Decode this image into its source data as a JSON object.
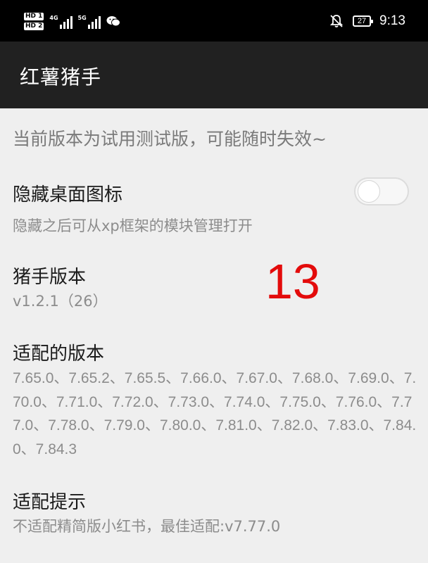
{
  "status_bar": {
    "sim1": "HD 1",
    "sim2": "HD 2",
    "net1": "4G",
    "net2": "5G",
    "battery": "27",
    "time": "9:13",
    "icons": [
      "signal-icon",
      "wechat-icon",
      "mute-bell-icon",
      "battery-icon"
    ]
  },
  "app_bar": {
    "title": "红薯猪手"
  },
  "notice": "当前版本为试用测试版，可能随时失效~",
  "hide_icon": {
    "title": "隐藏桌面图标",
    "subtitle": "隐藏之后可从xp框架的模块管理打开",
    "enabled": false
  },
  "version": {
    "title": "猪手版本",
    "value": "v1.2.1（26）"
  },
  "overlay_number": "13",
  "supported": {
    "title": "适配的版本",
    "list": "7.65.0、7.65.2、7.65.5、7.66.0、7.67.0、7.68.0、7.69.0、7.70.0、7.71.0、7.72.0、7.73.0、7.74.0、7.75.0、7.76.0、7.77.0、7.78.0、7.79.0、7.80.0、7.81.0、7.82.0、7.83.0、7.84.0、7.84.3"
  },
  "tip": {
    "title": "适配提示",
    "text": "不适配精简版小红书，最佳适配:v7.77.0"
  },
  "colors": {
    "accent_number": "#e30b0b",
    "appbar": "#212121",
    "background": "#efefef"
  }
}
